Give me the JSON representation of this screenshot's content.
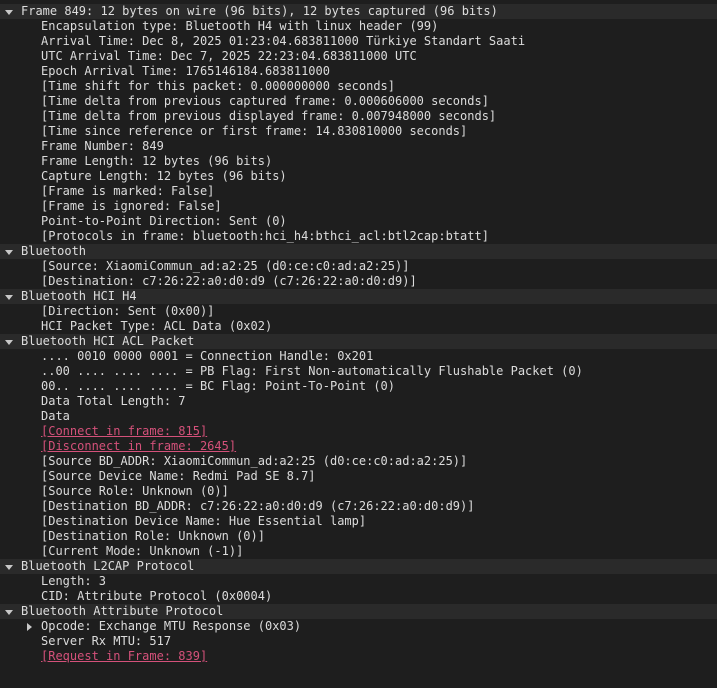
{
  "tree": [
    {
      "level": 0,
      "expanded": true,
      "header": true,
      "selected": true,
      "name": "frame-header",
      "text": "Frame 849: 12 bytes on wire (96 bits), 12 bytes captured (96 bits)"
    },
    {
      "level": 1,
      "name": "field-encapsulation-type",
      "text": "Encapsulation type: Bluetooth H4 with linux header (99)"
    },
    {
      "level": 1,
      "name": "field-arrival-time",
      "text": "Arrival Time: Dec  8, 2025 01:23:04.683811000 Türkiye Standart Saati"
    },
    {
      "level": 1,
      "name": "field-utc-arrival-time",
      "text": "UTC Arrival Time: Dec  7, 2025 22:23:04.683811000 UTC"
    },
    {
      "level": 1,
      "name": "field-epoch-arrival-time",
      "text": "Epoch Arrival Time: 1765146184.683811000"
    },
    {
      "level": 1,
      "name": "field-time-shift",
      "text": "[Time shift for this packet: 0.000000000 seconds]"
    },
    {
      "level": 1,
      "name": "field-time-delta-captured",
      "text": "[Time delta from previous captured frame: 0.000606000 seconds]"
    },
    {
      "level": 1,
      "name": "field-time-delta-displayed",
      "text": "[Time delta from previous displayed frame: 0.007948000 seconds]"
    },
    {
      "level": 1,
      "name": "field-time-since-reference",
      "text": "[Time since reference or first frame: 14.830810000 seconds]"
    },
    {
      "level": 1,
      "name": "field-frame-number",
      "text": "Frame Number: 849"
    },
    {
      "level": 1,
      "name": "field-frame-length",
      "text": "Frame Length: 12 bytes (96 bits)"
    },
    {
      "level": 1,
      "name": "field-capture-length",
      "text": "Capture Length: 12 bytes (96 bits)"
    },
    {
      "level": 1,
      "name": "field-frame-marked",
      "text": "[Frame is marked: False]"
    },
    {
      "level": 1,
      "name": "field-frame-ignored",
      "text": "[Frame is ignored: False]"
    },
    {
      "level": 1,
      "name": "field-p2p-direction",
      "text": "Point-to-Point Direction: Sent (0)"
    },
    {
      "level": 1,
      "name": "field-protocols-in-frame",
      "text": "[Protocols in frame: bluetooth:hci_h4:bthci_acl:btl2cap:btatt]"
    },
    {
      "level": 0,
      "expanded": true,
      "header": true,
      "name": "bluetooth-header",
      "text": "Bluetooth"
    },
    {
      "level": 1,
      "name": "field-bt-source",
      "text": "[Source: XiaomiCommun_ad:a2:25 (d0:ce:c0:ad:a2:25)]"
    },
    {
      "level": 1,
      "name": "field-bt-destination",
      "text": "[Destination: c7:26:22:a0:d0:d9 (c7:26:22:a0:d0:d9)]"
    },
    {
      "level": 0,
      "expanded": true,
      "header": true,
      "name": "hci-h4-header",
      "text": "Bluetooth HCI H4"
    },
    {
      "level": 1,
      "name": "field-h4-direction",
      "text": "[Direction: Sent (0x00)]"
    },
    {
      "level": 1,
      "name": "field-hci-packet-type",
      "text": "HCI Packet Type: ACL Data (0x02)"
    },
    {
      "level": 0,
      "expanded": true,
      "header": true,
      "name": "hci-acl-header",
      "text": "Bluetooth HCI ACL Packet"
    },
    {
      "level": 1,
      "name": "field-connection-handle",
      "text": ".... 0010 0000 0001 = Connection Handle: 0x201"
    },
    {
      "level": 1,
      "name": "field-pb-flag",
      "text": "..00 .... .... .... = PB Flag: First Non-automatically Flushable Packet (0)"
    },
    {
      "level": 1,
      "name": "field-bc-flag",
      "text": "00.. .... .... .... = BC Flag: Point-To-Point (0)"
    },
    {
      "level": 1,
      "name": "field-data-total-length",
      "text": "Data Total Length: 7"
    },
    {
      "level": 1,
      "name": "field-data",
      "text": "Data"
    },
    {
      "level": 1,
      "link": true,
      "name": "link-connect-in-frame",
      "text": "[Connect in frame: 815]"
    },
    {
      "level": 1,
      "link": true,
      "name": "link-disconnect-in-frame",
      "text": "[Disconnect in frame: 2645]"
    },
    {
      "level": 1,
      "name": "field-source-bd-addr",
      "text": "[Source BD_ADDR: XiaomiCommun_ad:a2:25 (d0:ce:c0:ad:a2:25)]"
    },
    {
      "level": 1,
      "name": "field-source-device-name",
      "text": "[Source Device Name: Redmi Pad SE 8.7]"
    },
    {
      "level": 1,
      "name": "field-source-role",
      "text": "[Source Role: Unknown (0)]"
    },
    {
      "level": 1,
      "name": "field-destination-bd-addr",
      "text": "[Destination BD_ADDR: c7:26:22:a0:d0:d9 (c7:26:22:a0:d0:d9)]"
    },
    {
      "level": 1,
      "name": "field-destination-device-name",
      "text": "[Destination Device Name: Hue Essential lamp]"
    },
    {
      "level": 1,
      "name": "field-destination-role",
      "text": "[Destination Role: Unknown (0)]"
    },
    {
      "level": 1,
      "name": "field-current-mode",
      "text": "[Current Mode: Unknown (-1)]"
    },
    {
      "level": 0,
      "expanded": true,
      "header": true,
      "name": "l2cap-header",
      "text": "Bluetooth L2CAP Protocol"
    },
    {
      "level": 1,
      "name": "field-l2cap-length",
      "text": "Length: 3"
    },
    {
      "level": 1,
      "name": "field-l2cap-cid",
      "text": "CID: Attribute Protocol (0x0004)"
    },
    {
      "level": 0,
      "expanded": true,
      "header": true,
      "name": "att-header",
      "text": "Bluetooth Attribute Protocol"
    },
    {
      "level": 1,
      "expanded": false,
      "name": "field-att-opcode",
      "text": "Opcode: Exchange MTU Response (0x03)"
    },
    {
      "level": 1,
      "name": "field-server-rx-mtu",
      "text": "Server Rx MTU: 517"
    },
    {
      "level": 1,
      "link": true,
      "name": "link-request-in-frame",
      "text": "[Request in Frame: 839]"
    }
  ]
}
